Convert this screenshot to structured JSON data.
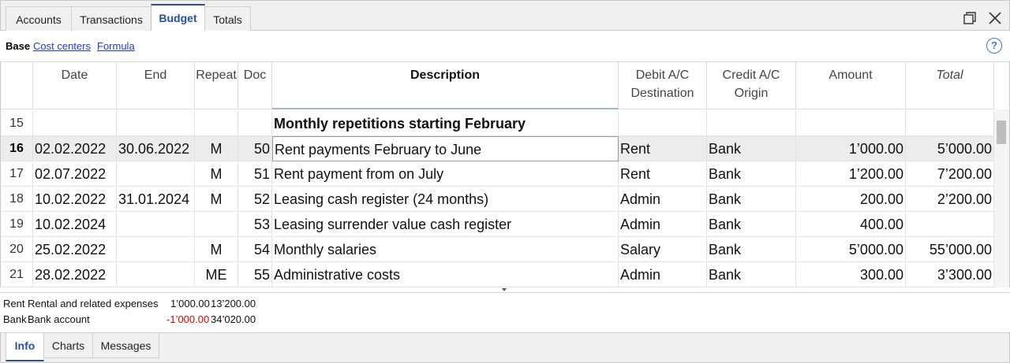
{
  "tabs": [
    "Accounts",
    "Transactions",
    "Budget",
    "Totals"
  ],
  "active_tab": "Budget",
  "window_icons": [
    "restore-icon",
    "close-icon"
  ],
  "subtabs": {
    "base": "Base",
    "links": [
      "Cost centers",
      "Formula"
    ]
  },
  "help_glyph": "?",
  "columns": {
    "date": "Date",
    "end": "End",
    "repeat": "Repeat",
    "doc": "Doc",
    "description": "Description",
    "debit": [
      "Debit A/C",
      "Destination"
    ],
    "credit": [
      "Credit A/C",
      "Origin"
    ],
    "amount": "Amount",
    "total": "Total"
  },
  "rows": [
    {
      "n": "15",
      "date": "",
      "end": "",
      "repeat": "",
      "doc": "",
      "description": "Monthly repetitions starting February",
      "debit": "",
      "credit": "",
      "amount": "",
      "total": ""
    },
    {
      "n": "16",
      "date": "02.02.2022",
      "end": "30.06.2022",
      "repeat": "M",
      "doc": "50",
      "description": "Rent payments February to June",
      "debit": "Rent",
      "credit": "Bank",
      "amount": "1’000.00",
      "total": "5’000.00"
    },
    {
      "n": "17",
      "date": "02.07.2022",
      "end": "",
      "repeat": "M",
      "doc": "51",
      "description": "Rent payment from on July",
      "debit": "Rent",
      "credit": "Bank",
      "amount": "1’200.00",
      "total": "7’200.00"
    },
    {
      "n": "18",
      "date": "10.02.2022",
      "end": "31.01.2024",
      "repeat": "M",
      "doc": "52",
      "description": "Leasing cash register (24 months)",
      "debit": "Admin",
      "credit": "Bank",
      "amount": "200.00",
      "total": "2’200.00"
    },
    {
      "n": "19",
      "date": "10.02.2024",
      "end": "",
      "repeat": "",
      "doc": "53",
      "description": "Leasing surrender value cash register",
      "debit": "Admin",
      "credit": "Bank",
      "amount": "400.00",
      "total": ""
    },
    {
      "n": "20",
      "date": "25.02.2022",
      "end": "",
      "repeat": "M",
      "doc": "54",
      "description": "Monthly salaries",
      "debit": "Salary",
      "credit": "Bank",
      "amount": "5’000.00",
      "total": "55’000.00"
    },
    {
      "n": "21",
      "date": "28.02.2022",
      "end": "",
      "repeat": "ME",
      "doc": "55",
      "description": "Administrative costs",
      "debit": "Admin",
      "credit": "Bank",
      "amount": "300.00",
      "total": "3’300.00"
    }
  ],
  "selected_row": "16",
  "info": [
    {
      "account": "Rent",
      "name": "Rental and related expenses",
      "amount": "1’000.00",
      "balance": "13’200.00",
      "negative": false
    },
    {
      "account": "Bank",
      "name": "Bank account",
      "amount": "-1’000.00",
      "balance": "34’020.00",
      "negative": true
    }
  ],
  "bottom_tabs": [
    "Info",
    "Charts",
    "Messages"
  ],
  "active_bottom_tab": "Info",
  "colors": {
    "accent": "#2b4f9a",
    "link": "#1a3fd1",
    "negative": "#e00000",
    "help": "#3a7bd5"
  }
}
